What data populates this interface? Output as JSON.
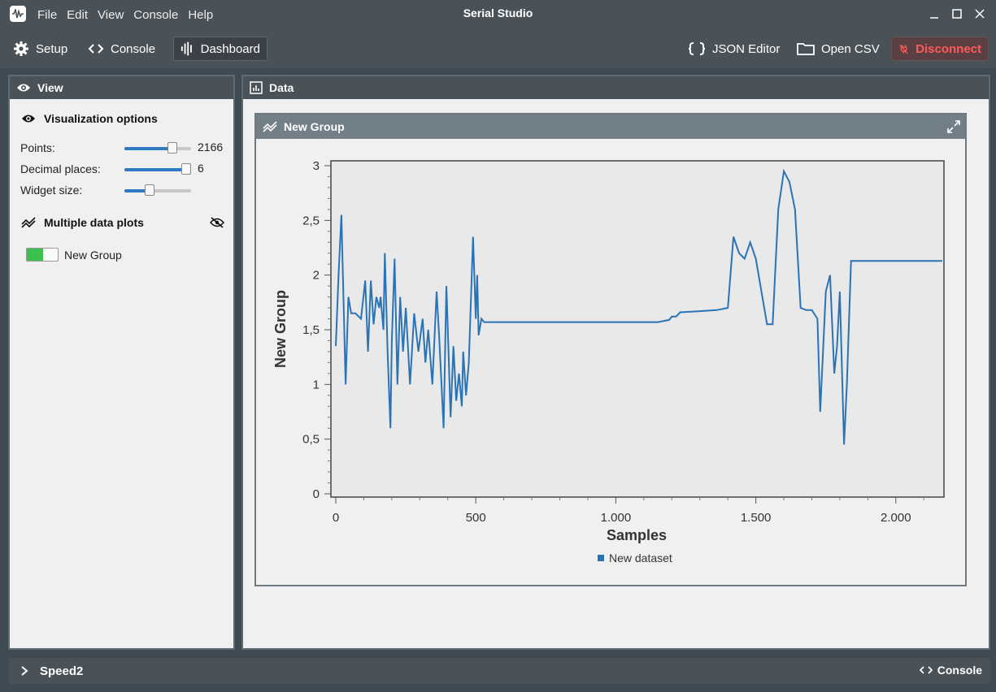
{
  "window": {
    "title": "Serial Studio"
  },
  "menu": {
    "items": [
      "File",
      "Edit",
      "View",
      "Console",
      "Help"
    ]
  },
  "toolbar": {
    "setup_label": "Setup",
    "console_label": "Console",
    "dashboard_label": "Dashboard",
    "json_editor_label": "JSON Editor",
    "open_csv_label": "Open CSV",
    "disconnect_label": "Disconnect",
    "disconnect_color": "#ff5a5a"
  },
  "view_panel": {
    "title": "View",
    "visualization_title": "Visualization options",
    "points_label": "Points:",
    "points_value": "2166",
    "points_fraction": 0.75,
    "decimal_label": "Decimal places:",
    "decimal_value": "6",
    "decimal_fraction": 1.0,
    "widget_size_label": "Widget size:",
    "widget_size_fraction": 0.35,
    "multiplot_title": "Multiple data plots",
    "group_toggle_label": "New Group",
    "group_toggle_on": true
  },
  "data_panel": {
    "title": "Data"
  },
  "group": {
    "title": "New Group"
  },
  "bottom_bar": {
    "label": "Speed2",
    "console_label": "Console"
  },
  "colors": {
    "series": "#2a74b5",
    "accent": "#2e7bc4",
    "toggle_on": "#3cc14f"
  },
  "chart_data": {
    "type": "line",
    "xlabel": "Samples",
    "ylabel": "New Group",
    "xlim": [
      0,
      2166
    ],
    "ylim": [
      0,
      3
    ],
    "x_ticks": [
      0,
      500,
      1000,
      1500,
      2000
    ],
    "x_tick_labels": [
      "0",
      "500",
      "1.000",
      "1.500",
      "2.000"
    ],
    "y_ticks": [
      0,
      0.5,
      1,
      1.5,
      2,
      2.5,
      3
    ],
    "y_tick_labels": [
      "0",
      "0,5",
      "1",
      "1,5",
      "2",
      "2,5",
      "3"
    ],
    "legend_position": "bottom",
    "series": [
      {
        "name": "New dataset",
        "x": [
          0,
          10,
          20,
          35,
          45,
          55,
          70,
          90,
          105,
          115,
          125,
          135,
          145,
          155,
          160,
          170,
          175,
          185,
          195,
          200,
          210,
          220,
          230,
          240,
          250,
          265,
          280,
          295,
          310,
          320,
          330,
          345,
          360,
          370,
          385,
          395,
          400,
          410,
          420,
          430,
          440,
          450,
          455,
          465,
          475,
          490,
          500,
          505,
          510,
          520,
          530,
          550,
          600,
          800,
          1000,
          1150,
          1190,
          1200,
          1215,
          1230,
          1300,
          1360,
          1400,
          1420,
          1440,
          1460,
          1480,
          1500,
          1520,
          1540,
          1560,
          1580,
          1600,
          1620,
          1640,
          1660,
          1680,
          1700,
          1720,
          1730,
          1750,
          1765,
          1780,
          1790,
          1800,
          1815,
          1825,
          1840,
          1855,
          1870,
          2000,
          2166
        ],
        "y": [
          1.35,
          2.0,
          2.55,
          1.0,
          1.8,
          1.65,
          1.65,
          1.6,
          1.95,
          1.3,
          1.95,
          1.55,
          1.8,
          1.7,
          1.8,
          1.5,
          2.2,
          1.3,
          0.6,
          1.4,
          2.15,
          1.0,
          1.8,
          1.3,
          1.7,
          1.0,
          1.65,
          1.3,
          1.6,
          1.2,
          1.5,
          1.0,
          1.85,
          1.4,
          0.6,
          1.9,
          1.5,
          0.7,
          1.35,
          0.85,
          1.1,
          0.8,
          1.3,
          0.9,
          1.2,
          2.35,
          1.6,
          2.0,
          1.45,
          1.6,
          1.57,
          1.57,
          1.57,
          1.57,
          1.57,
          1.57,
          1.59,
          1.62,
          1.62,
          1.66,
          1.67,
          1.68,
          1.7,
          2.35,
          2.2,
          2.15,
          2.3,
          2.15,
          1.85,
          1.55,
          1.55,
          2.6,
          2.95,
          2.85,
          2.6,
          1.7,
          1.68,
          1.68,
          1.6,
          0.75,
          1.85,
          2.0,
          1.1,
          1.35,
          1.85,
          0.45,
          1.0,
          2.13,
          2.13,
          2.13,
          2.13,
          2.13
        ]
      }
    ]
  }
}
